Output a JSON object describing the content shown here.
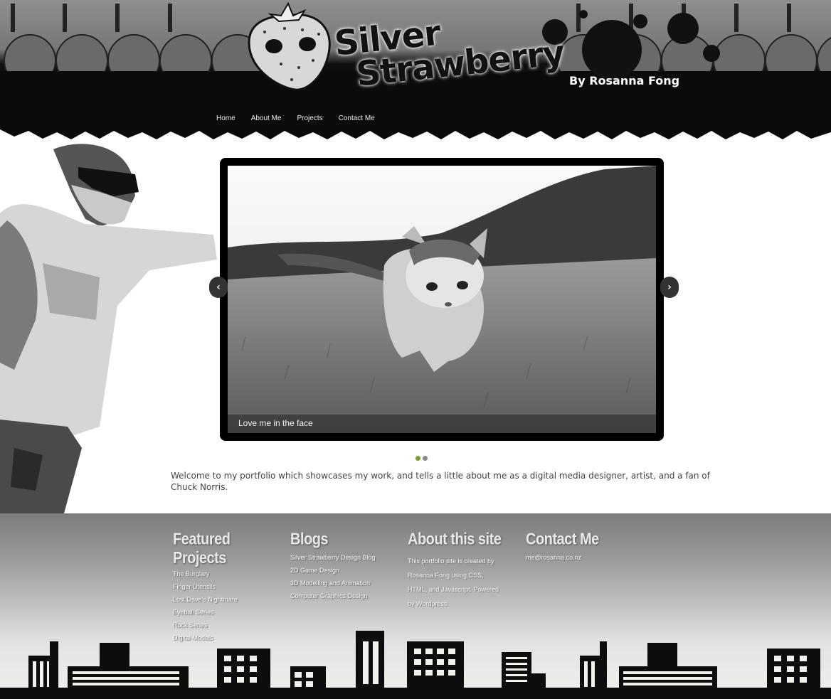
{
  "header": {
    "logo_line1": "Silver",
    "logo_line2": "Strawberry",
    "byline": "By Rosanna Fong",
    "nav": [
      "Home",
      "About Me",
      "Projects",
      "Contact Me"
    ]
  },
  "slider": {
    "caption": "Love me in the face",
    "prev_glyph": "‹",
    "next_glyph": "›",
    "slide_count": 2,
    "active_slide": 1
  },
  "intro": "Welcome to my portfolio which showcases my work, and tells a little about me as a digital media designer, artist, and a fan of Chuck Norris.",
  "footer": {
    "featured": {
      "title": "Featured Projects",
      "items": [
        "The Burglary",
        "Finger Utensils",
        "Lost Dave's Nightmare",
        "Eyeball Series",
        "Rock Series",
        "Digital Models"
      ]
    },
    "blogs": {
      "title": "Blogs",
      "items": [
        "Silver Strawberry Design Blog",
        "2D Game Design",
        "3D Modelling and Animation",
        "Computer Graphics Design"
      ]
    },
    "about": {
      "title": "About this site",
      "text": "This portfolio site is created by Rosanna Fong using CSS, HTML, and Javascript. Powered by Wordpress."
    },
    "contact": {
      "title": "Contact Me",
      "email": "me@rosanna.co.nz"
    }
  },
  "colors": {
    "active_dot": "#7aa02c",
    "header_dark": "#0a0a0a",
    "logo_red": "#e01010"
  }
}
